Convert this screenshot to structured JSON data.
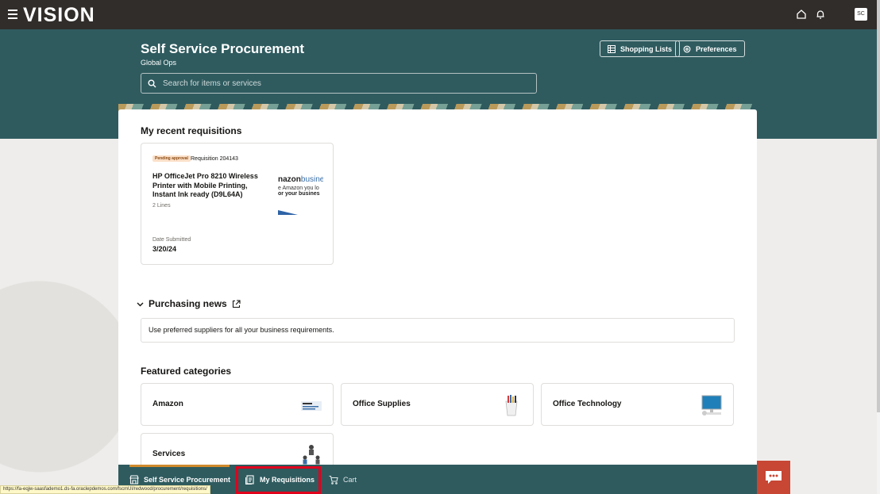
{
  "header": {
    "logo": "VISION",
    "avatar_initials": "SC"
  },
  "hero": {
    "title": "Self Service Procurement",
    "subtitle": "Global Ops",
    "shopping_lists_label": "Shopping Lists",
    "preferences_label": "Preferences",
    "search_placeholder": "Search for items or services"
  },
  "recent": {
    "heading": "My recent requisitions",
    "card": {
      "status": "Pending approval",
      "requisition": "Requisition 204143",
      "title": "HP OfficeJet Pro 8210 Wireless Printer with Mobile Printing, Instant Ink ready (D9L64A)",
      "lines": "2 Lines",
      "date_label": "Date Submitted",
      "date_value": "3/20/24",
      "thumb_line1a": "nazon",
      "thumb_line1b": "busine",
      "thumb_line2": "e Amazon you lo",
      "thumb_line3": "or your busines"
    }
  },
  "news": {
    "heading": "Purchasing news",
    "message": "Use preferred suppliers for all your business requirements."
  },
  "categories": {
    "heading": "Featured categories",
    "items": [
      {
        "name": "Amazon"
      },
      {
        "name": "Office Supplies"
      },
      {
        "name": "Office Technology"
      },
      {
        "name": "Services"
      }
    ]
  },
  "bottom_nav": {
    "tabs": [
      {
        "label": "Self Service Procurement"
      },
      {
        "label": "My Requisitions"
      },
      {
        "label": "Cart"
      }
    ]
  },
  "status_url": "https://fa-eqjw-saasfademo1.ds-fa.oraclepdemos.com/fscmUI/redwood/procurement/requisitions/",
  "colors": {
    "hero": "#2f5b5f",
    "topbar": "#312d2a",
    "accent": "#c74634",
    "highlight": "#e0001b"
  }
}
